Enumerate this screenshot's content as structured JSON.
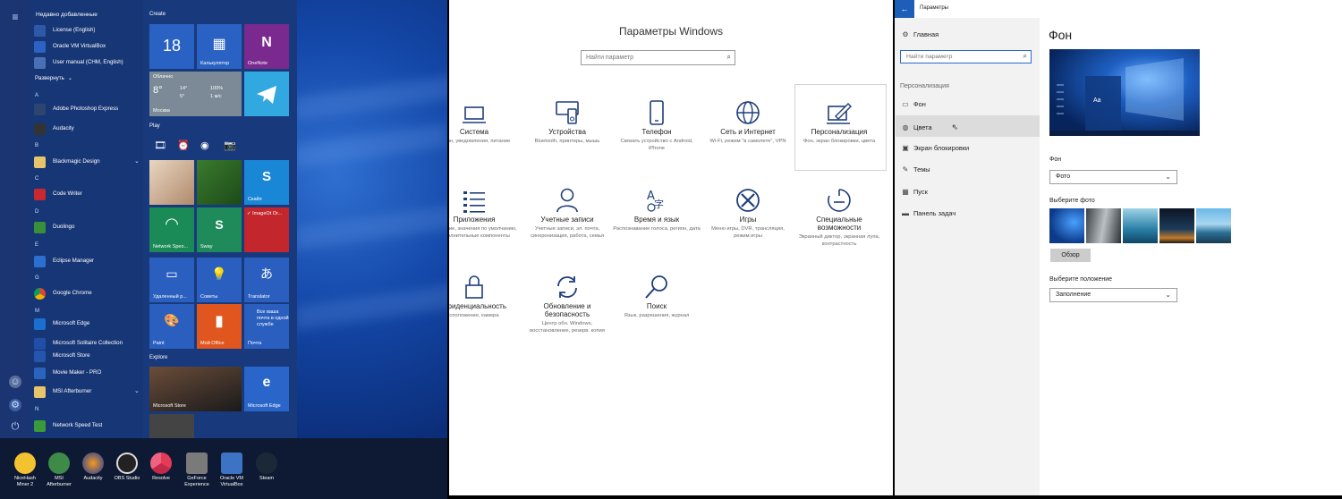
{
  "start_menu": {
    "recent_header": "Недавно добавленные",
    "recent": [
      "License (English)",
      "Oracle VM VirtualBox",
      "User manual (CHM, English)"
    ],
    "expand_label": "Развернуть",
    "letters": {
      "a": "A",
      "b": "B",
      "c": "C",
      "d": "D",
      "e": "E",
      "g": "G",
      "m": "M",
      "n": "N"
    },
    "apps": {
      "photoshop": "Adobe Photoshop Express",
      "audacity": "Audacity",
      "blackmagic": "Blackmagic Design",
      "codewriter": "Code Writer",
      "duolingo": "Duolingo",
      "eclipse": "Eclipse Manager",
      "chrome": "Google Chrome",
      "edge": "Microsoft Edge",
      "solitaire": "Microsoft Solitaire Collection",
      "store": "Microsoft Store",
      "moviemaker": "Movie Maker - PRO",
      "afterburner": "MSI Afterburner",
      "speedtest": "Network Speed Test"
    },
    "groups": {
      "create": "Create",
      "play": "Play",
      "explore": "Explore"
    },
    "tiles": {
      "cal_day": "18",
      "calc": "Калькулятор",
      "onenote": "OneNote",
      "weather_desc": "Облачно",
      "weather_temp": "8°",
      "weather_hi": "14°",
      "weather_lo": "5°",
      "weather_hum": "100%",
      "weather_wind": "1 м/с",
      "weather_city": "Москва",
      "skype": "Скайп",
      "network": "Network Speo...",
      "sway": "Sway",
      "imageoit": "✓ ImageOt Or...",
      "remote": "Удаленный р...",
      "tips": "Советы",
      "translator": "Translator",
      "paint": "Paint",
      "myoffice": "Мой Office",
      "mail": "Почта",
      "mail_text": "Все ваша почта в одной службе",
      "store": "Microsoft Store",
      "edge": "Microsoft Edge"
    }
  },
  "taskbar": {
    "items": [
      {
        "l1": "NiceHash",
        "l2": "Miner 2"
      },
      {
        "l1": "MSI",
        "l2": "Afterburner"
      },
      {
        "l1": "Audacity",
        "l2": ""
      },
      {
        "l1": "OBS Studio",
        "l2": ""
      },
      {
        "l1": "Resolve",
        "l2": ""
      },
      {
        "l1": "GeForce",
        "l2": "Experience"
      },
      {
        "l1": "Oracle VM",
        "l2": "VirtualBox"
      },
      {
        "l1": "Steam",
        "l2": ""
      }
    ]
  },
  "settings_home": {
    "title": "Параметры Windows",
    "search_placeholder": "Найти параметр",
    "categories": [
      {
        "name": "Система",
        "desc": "Экран, уведомления, питание"
      },
      {
        "name": "Устройства",
        "desc": "Bluetooth, принтеры, мышь"
      },
      {
        "name": "Телефон",
        "desc": "Связать устройство с Android, iPhone"
      },
      {
        "name": "Сеть и Интернет",
        "desc": "Wi-Fi, режим \"в самолете\", VPN"
      },
      {
        "name": "Персонализация",
        "desc": "Фон, экран блокировки, цвета"
      },
      {
        "name": "Приложения",
        "desc": "Удаление, значения по умолчанию, дополнительные компоненты"
      },
      {
        "name": "Учетные записи",
        "desc": "Учетные записи, эл. почта, синхронизация, работа, семья"
      },
      {
        "name": "Время и язык",
        "desc": "Распознавание голоса, регион, дата"
      },
      {
        "name": "Игры",
        "desc": "Меню игры, DVR, трансляция, режим игры"
      },
      {
        "name": "Специальные возможности",
        "desc": "Экранный диктор, экранная лупа, контрастность"
      },
      {
        "name": "нфиденциальность",
        "desc": "сположение, камера"
      },
      {
        "name": "Обновление и безопасность",
        "desc": "Центр обн. Windows, восстановление, резерв. копия"
      },
      {
        "name": "Поиск",
        "desc": "Язык, разрешения, журнал"
      }
    ]
  },
  "personalization": {
    "window_title": "Параметры",
    "home": "Главная",
    "search_placeholder": "Найти параметр",
    "section": "Персонализация",
    "nav": [
      "Фон",
      "Цвета",
      "Экран блокировки",
      "Темы",
      "Пуск",
      "Панель задач"
    ],
    "page_title": "Фон",
    "preview_text": "Aa",
    "bg_label": "Фон",
    "bg_value": "Фото",
    "photo_label": "Выберите фото",
    "browse": "Обзор",
    "position_label": "Выберите положение",
    "position_value": "Заполнение"
  }
}
